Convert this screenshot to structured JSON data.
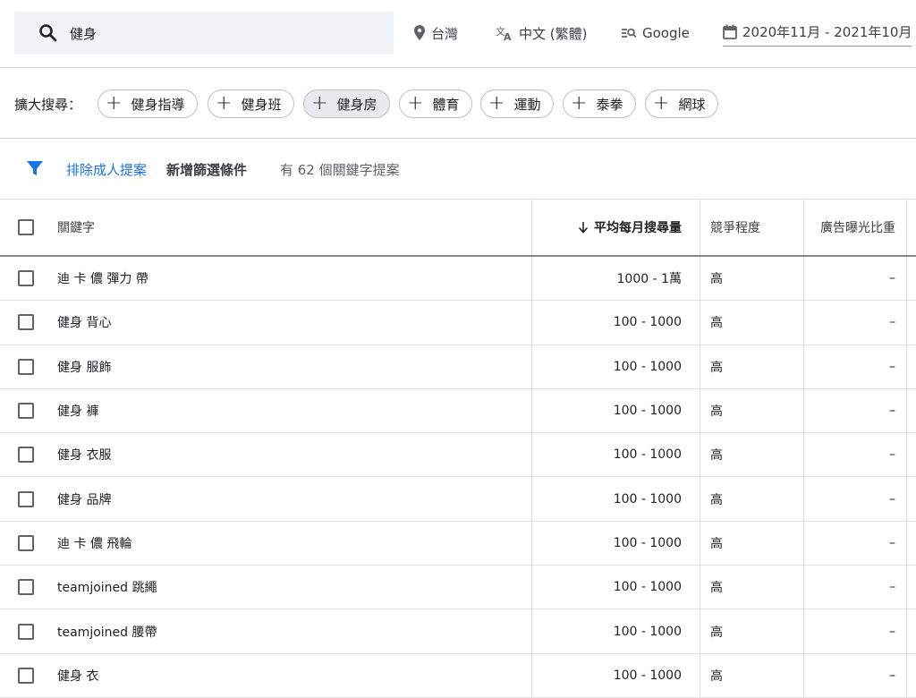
{
  "search": {
    "value": "健身"
  },
  "filters": {
    "location": "台灣",
    "language": "中文 (繁體)",
    "network": "Google",
    "date_range": "2020年11月 - 2021年10月"
  },
  "broaden": {
    "label": "擴大搜尋：",
    "chips": [
      {
        "label": "健身指導",
        "active": false
      },
      {
        "label": "健身班",
        "active": false
      },
      {
        "label": "健身房",
        "active": true
      },
      {
        "label": "體育",
        "active": false
      },
      {
        "label": "運動",
        "active": false
      },
      {
        "label": "泰拳",
        "active": false
      },
      {
        "label": "網球",
        "active": false
      }
    ]
  },
  "filter_bar": {
    "exclude_adult": "排除成人提案",
    "add_filter": "新增篩選條件",
    "result_count": "有 62 個關鍵字提案"
  },
  "table": {
    "columns": {
      "keyword": "關鍵字",
      "avg_monthly": "平均每月搜尋量",
      "competition": "競爭程度",
      "impression_share": "廣告曝光比重"
    },
    "rows": [
      {
        "keyword": "迪 卡 儂 彈力 帶",
        "avg_monthly": "1000 - 1萬",
        "competition": "高",
        "impression_share": "–"
      },
      {
        "keyword": "健身 背心",
        "avg_monthly": "100 - 1000",
        "competition": "高",
        "impression_share": "–"
      },
      {
        "keyword": "健身 服飾",
        "avg_monthly": "100 - 1000",
        "competition": "高",
        "impression_share": "–"
      },
      {
        "keyword": "健身 褲",
        "avg_monthly": "100 - 1000",
        "competition": "高",
        "impression_share": "–"
      },
      {
        "keyword": "健身 衣服",
        "avg_monthly": "100 - 1000",
        "competition": "高",
        "impression_share": "–"
      },
      {
        "keyword": "健身 品牌",
        "avg_monthly": "100 - 1000",
        "competition": "高",
        "impression_share": "–"
      },
      {
        "keyword": "迪 卡 儂 飛輪",
        "avg_monthly": "100 - 1000",
        "competition": "高",
        "impression_share": "–"
      },
      {
        "keyword": "teamjoined 跳繩",
        "avg_monthly": "100 - 1000",
        "competition": "高",
        "impression_share": "–"
      },
      {
        "keyword": "teamjoined 腰帶",
        "avg_monthly": "100 - 1000",
        "competition": "高",
        "impression_share": "–"
      },
      {
        "keyword": "健身 衣",
        "avg_monthly": "100 - 1000",
        "competition": "高",
        "impression_share": "–"
      }
    ]
  },
  "colors": {
    "accent": "#1a73e8",
    "divider": "#dadce0",
    "search_bg": "#f1f3f4"
  }
}
